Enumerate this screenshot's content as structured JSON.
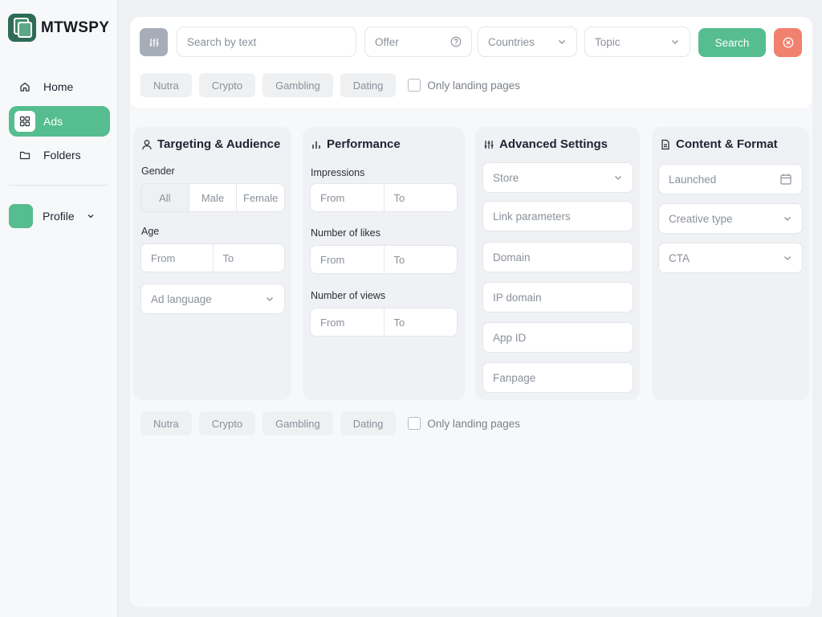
{
  "brand": {
    "name": "MTWSPY",
    "accent": "#55bd8f",
    "danger": "#f0816f"
  },
  "sidebar": {
    "items": [
      {
        "label": "Home",
        "icon": "home-icon",
        "active": false
      },
      {
        "label": "Ads",
        "icon": "grid-icon",
        "active": true
      },
      {
        "label": "Folders",
        "icon": "folder-icon",
        "active": false
      }
    ],
    "profile": {
      "label": "Profile"
    }
  },
  "topbar": {
    "search_placeholder": "Search by text",
    "offer_placeholder": "Offer",
    "countries_label": "Countries",
    "topic_label": "Topic",
    "search_button": "Search"
  },
  "chips": [
    "Nutra",
    "Crypto",
    "Gambling",
    "Dating"
  ],
  "only_landing_label": "Only landing pages",
  "targeting": {
    "title": "Targeting & Audience",
    "gender_label": "Gender",
    "gender_options": [
      "All",
      "Male",
      "Female"
    ],
    "age_label": "Age",
    "age_from": "From",
    "age_to": "To",
    "language_label": "Ad language"
  },
  "performance": {
    "title": "Performance",
    "impressions_label": "Impressions",
    "likes_label": "Number of likes",
    "views_label": "Number of views",
    "from": "From",
    "to": "To"
  },
  "advanced": {
    "title": "Advanced Settings",
    "store_label": "Store",
    "fields": [
      "Link parameters",
      "Domain",
      "IP domain",
      "App ID",
      "Fanpage"
    ]
  },
  "content": {
    "title": "Content & Format",
    "launched_label": "Launched",
    "creative_label": "Creative type",
    "cta_label": "CTA"
  }
}
